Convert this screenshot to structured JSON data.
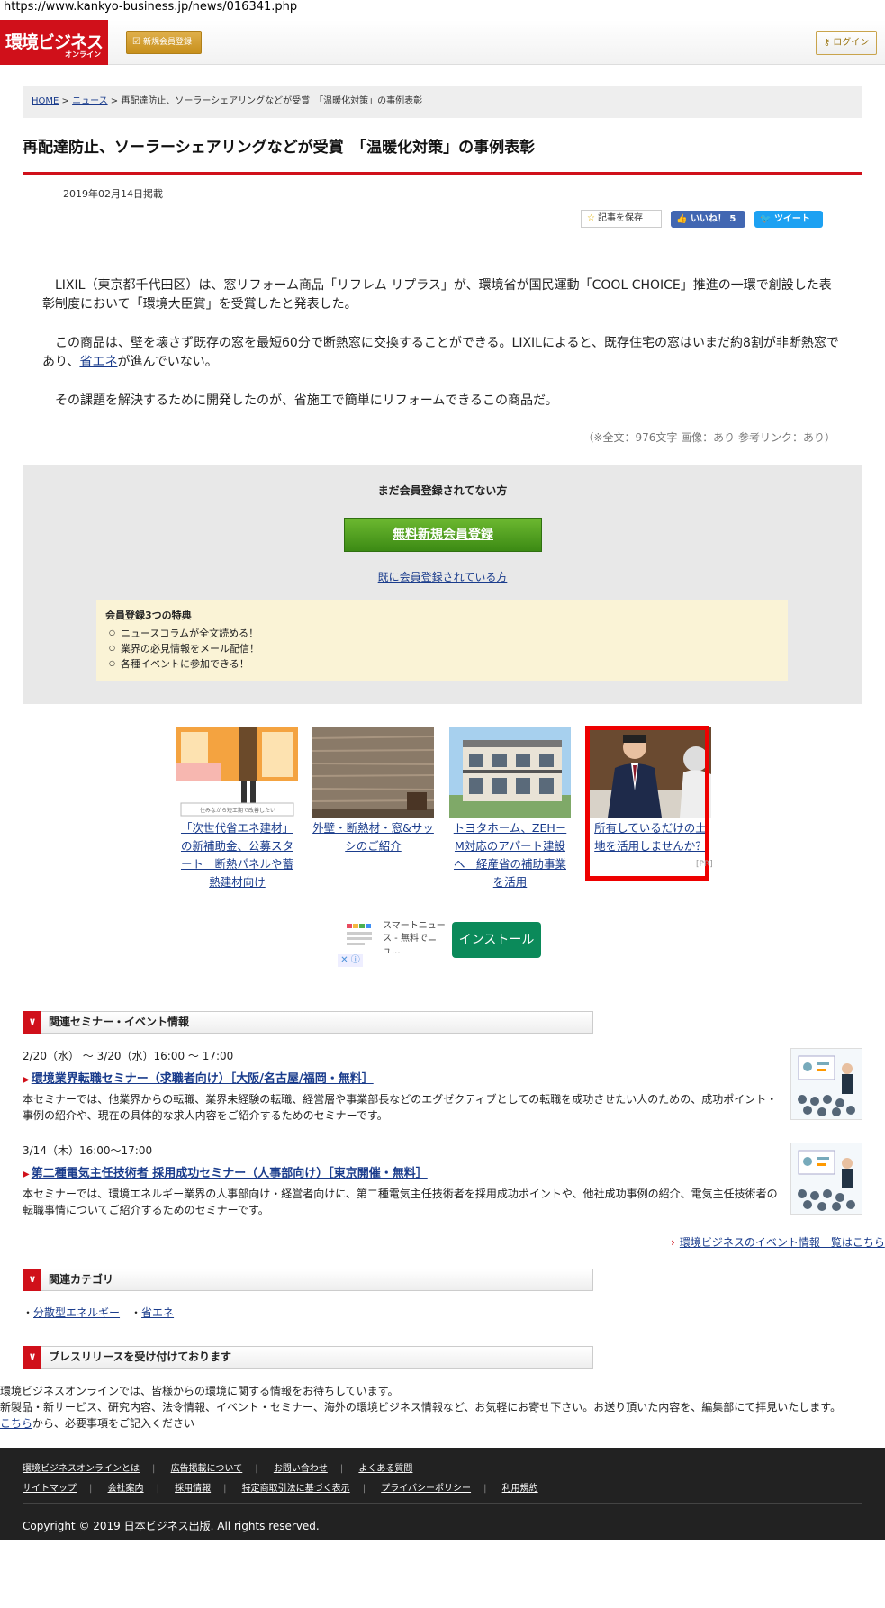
{
  "url": "https://www.kankyo-business.jp/news/016341.php",
  "header": {
    "logo_main": "環境ビジネス",
    "logo_sub": "オンライン",
    "register_label": "新規会員登録",
    "login_label": "ログイン"
  },
  "breadcrumb": {
    "home": "HOME",
    "news": "ニュース",
    "current": "再配達防止、ソーラーシェアリングなどが受賞　「温暖化対策」の事例表彰"
  },
  "article": {
    "title": "再配達防止、ソーラーシェアリングなどが受賞　「温暖化対策」の事例表彰",
    "date": "2019年02月14日掲載",
    "save_label": "記事を保存",
    "like_label": "いいね！ 5",
    "tweet_label": "ツイート",
    "p1": "LIXIL（東京都千代田区）は、窓リフォーム商品「リフレム リプラス」が、環境省が国民運動「COOL CHOICE」推進の一環で創設した表彰制度において「環境大臣賞」を受賞したと発表した。",
    "p2a": "この商品は、壁を壊さず既存の窓を最短60分で断熱窓に交換することができる。LIXILによると、既存住宅の窓はいまだ約8割が非断熱窓であり、",
    "p2link": "省エネ",
    "p2b": "が進んでいない。",
    "p3": "その課題を解決するために開発したのが、省施工で簡単にリフォームできるこの商品だ。",
    "meta": "（※全文：976文字 画像：あり 参考リンク：あり）"
  },
  "register_box": {
    "question": "まだ会員登録されてない方",
    "free_button": "無料新規会員登録",
    "already": "既に会員登録されている方",
    "perks_title": "会員登録3つの特典",
    "perks": [
      "ニュースコラムが全文読める！",
      "業界の必見情報をメール配信！",
      "各種イベントに参加できる！"
    ]
  },
  "ads": [
    {
      "text": "「次世代省エネ建材」の新補助金、公募スタート　断熱パネルや蓄熱建材向け",
      "caption": "住みながら短工期で改善したい"
    },
    {
      "text": "外壁・断熱材・窓&サッシのご紹介"
    },
    {
      "text": "トヨタホーム、ZEH－M対応のアパート建設へ　経産省の補助事業を活用"
    },
    {
      "text": "所有しているだけの土地を活用しませんか？",
      "badge": "[PR]"
    }
  ],
  "app_ad": {
    "text": "スマートニュース - 無料でニュ...",
    "install": "インストール",
    "close": "✕ ⓘ"
  },
  "seminars": {
    "header": "関連セミナー・イベント情報",
    "items": [
      {
        "date": "2/20（水） ～ 3/20（水）16:00 ～ 17:00",
        "title": "環境業界転職セミナー（求職者向け）［大阪/名古屋/福岡・無料］",
        "desc": "本セミナーでは、他業界からの転職、業界未経験の転職、経営層や事業部長などのエグゼクティブとしての転職を成功させたい人のための、成功ポイント・事例の紹介や、現在の具体的な求人内容をご紹介するためのセミナーです。"
      },
      {
        "date": "3/14（木）16:00～17:00",
        "title": "第二種電気主任技術者 採用成功セミナー（人事部向け）［東京開催・無料］",
        "desc": "本セミナーでは、環境エネルギー業界の人事部向け・経営者向けに、第二種電気主任技術者を採用成功ポイントや、他社成功事例の紹介、電気主任技術者の転職事情についてご紹介するためのセミナーです。"
      }
    ],
    "list_link": "環境ビジネスのイベント情報一覧はこちら"
  },
  "categories": {
    "header": "関連カテゴリ",
    "items": [
      "分散型エネルギー",
      "省エネ"
    ]
  },
  "press": {
    "header": "プレスリリースを受け付けております",
    "line1": "環境ビジネスオンラインでは、皆様からの環境に関する情報をお待ちしています。",
    "line2": "新製品・新サービス、研究内容、法令情報、イベント・セミナー、海外の環境ビジネス情報など、お気軽にお寄せ下さい。お送り頂いた内容を、編集部にて拝見いたします。",
    "link": "こちら",
    "line3": "から、必要事項をご記入ください"
  },
  "footer": {
    "row1": [
      "環境ビジネスオンラインとは",
      "広告掲載について",
      "お問い合わせ",
      "よくある質問"
    ],
    "row2": [
      "サイトマップ",
      "会社案内",
      "採用情報",
      "特定商取引法に基づく表示",
      "プライバシーポリシー",
      "利用規約"
    ],
    "copyright": "Copyright © 2019 日本ビジネス出版. All rights reserved."
  },
  "colors": {
    "brand_red": "#d0101a",
    "link": "#1a3c8c",
    "install_green": "#0b8a5a"
  }
}
